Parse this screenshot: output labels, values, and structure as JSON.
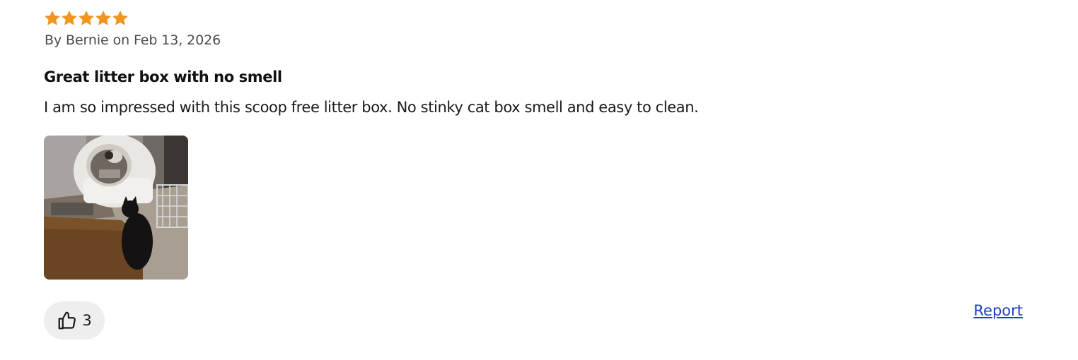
{
  "review": {
    "rating": 5,
    "rating_max": 5,
    "star_color": "#f0961e",
    "byline": "By Bernie on Feb 13, 2026",
    "title": "Great litter box with no smell",
    "body": "I am so impressed with this scoop free litter box. No stinky cat box smell and easy to clean.",
    "photo_icon": "review-photo"
  },
  "actions": {
    "helpful_icon": "thumbs-up-icon",
    "helpful_count": "3",
    "report_label": "Report",
    "link_color": "#1f3fbf"
  }
}
